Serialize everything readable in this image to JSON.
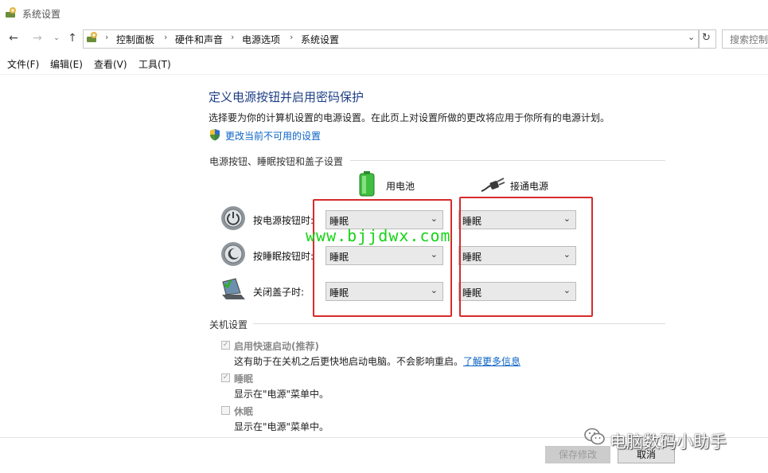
{
  "window": {
    "title": "系统设置"
  },
  "nav": {
    "breadcrumbs": [
      "控制面板",
      "硬件和声音",
      "电源选项",
      "系统设置"
    ],
    "search_placeholder": "搜索控制"
  },
  "menu": [
    "文件(F)",
    "编辑(E)",
    "查看(V)",
    "工具(T)"
  ],
  "page": {
    "heading": "定义电源按钮并启用密码保护",
    "description": "选择要为你的计算机设置的电源设置。在此页上对设置所做的更改将应用于你所有的电源计划。",
    "change_link": "更改当前不可用的设置"
  },
  "power_section": {
    "title": "电源按钮、睡眠按钮和盖子设置",
    "battery_label": "用电池",
    "plugged_label": "接通电源",
    "rows": [
      {
        "label": "按电源按钮时:",
        "battery": "睡眠",
        "plugged": "睡眠",
        "icon": "power-button-icon"
      },
      {
        "label": "按睡眠按钮时:",
        "battery": "睡眠",
        "plugged": "睡眠",
        "icon": "sleep-button-icon"
      },
      {
        "label": "关闭盖子时:",
        "battery": "睡眠",
        "plugged": "睡眠",
        "icon": "laptop-lid-icon"
      }
    ]
  },
  "shutdown_section": {
    "title": "关机设置",
    "options": [
      {
        "title": "启用快速启动(推荐)",
        "desc": "这有助于在关机之后更快地启动电脑。不会影响重启。",
        "link": "了解更多信息",
        "checked": true
      },
      {
        "title": "睡眠",
        "desc": "显示在\"电源\"菜单中。",
        "checked": true
      },
      {
        "title": "休眠",
        "desc": "显示在\"电源\"菜单中。",
        "checked": false
      }
    ]
  },
  "buttons": {
    "save": "保存修改",
    "cancel": "取消"
  },
  "watermark": "www.bjjdwx.com",
  "brand_overlay": "电脑数码小助手",
  "colors": {
    "accent_heading": "#1e3f86",
    "link": "#0b64c4",
    "highlight_box": "#d62c2c",
    "watermark": "#16d416"
  }
}
